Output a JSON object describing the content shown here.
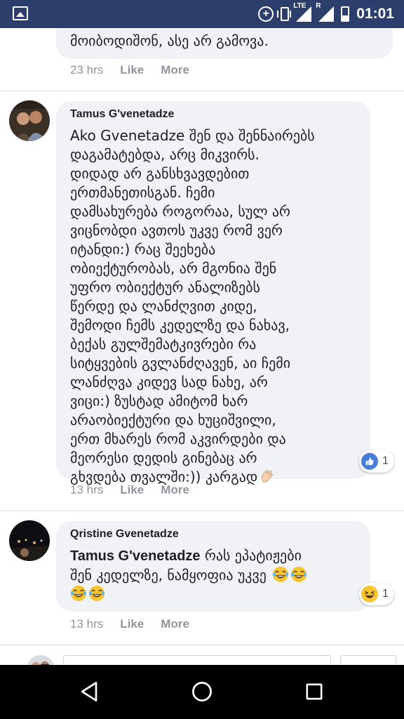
{
  "status_bar": {
    "left_icon": "image-notification-icon",
    "icons": [
      "data-saver-icon",
      "vibrate-icon",
      "lte-signal-icon",
      "roaming-signal-icon",
      "battery-icon"
    ],
    "lte_label": "LTE",
    "roaming_label": "R",
    "data_saver_label": "+",
    "time": "01:01"
  },
  "comments": [
    {
      "author": "",
      "text": "მოიბოდიშონ, ასე არ გამოვა.",
      "time": "23 hrs",
      "like_label": "Like",
      "more_label": "More"
    },
    {
      "author": "Tamus G'venetadze",
      "text_lines": [
        "Ako Gvenetadze შენ და შენნაირებს",
        "დაგამატებდა, არც მიკვირს.",
        "დიდად არ განსხვავდებით",
        "ერთმანეთისგან. ჩემი",
        "დამსახურება როგორაა, სულ არ",
        "ვიცნობდი ავთოს უკვე რომ ვერ",
        "იტანდი:) რაც შეეხება",
        "ობიექტურობას, არ მგონია შენ",
        "უფრო ობიექტურ ანალიზებს",
        "წერდე და ლანძღვით კიდე,",
        "შემოდი ჩემს კედელზე და ნახავ,",
        "ბექას გულშემატკივრები რა",
        "სიტყვების გვლანძღავენ, აი ჩემი",
        "ლანძღვა კიდევ სად ნახე, არ",
        "ვიცი:) ზუსტად ამიტომ ხარ",
        "არაობიექტური და ხუციშვილი,",
        "ერთ მხარეს რომ აკვირდები და",
        "მეორესი დედის გინებაც არ",
        "გხვდება თვალში:)) კარგად"
      ],
      "trailing_emoji": "clapping-hands-emoji",
      "reaction_icon": "like-icon",
      "reaction_count": "1",
      "time": "13 hrs",
      "like_label": "Like",
      "more_label": "More"
    },
    {
      "author": "Qristine Gvenetadze",
      "mention": "Tamus G'venetadze",
      "text_line1": "რას ეპატიჟები",
      "text_line2": "შენ კედელზე, ნამყოფია უკვე",
      "emojis": [
        "tears-of-joy-emoji",
        "tears-of-joy-emoji",
        "tears-of-joy-emoji",
        "tears-of-joy-emoji"
      ],
      "reaction_icon": "haha-icon",
      "reaction_count": "1",
      "time": "13 hrs",
      "like_label": "Like",
      "more_label": "More"
    }
  ],
  "nav_bar": {
    "buttons": [
      "back-icon",
      "home-icon",
      "recents-icon"
    ]
  },
  "colors": {
    "status_bar": "#2c3e6b",
    "bubble": "#f1f2f6",
    "meta_text": "#90949c",
    "like_blue": "#4a7dd9",
    "haha_yellow": "#f7c531"
  }
}
